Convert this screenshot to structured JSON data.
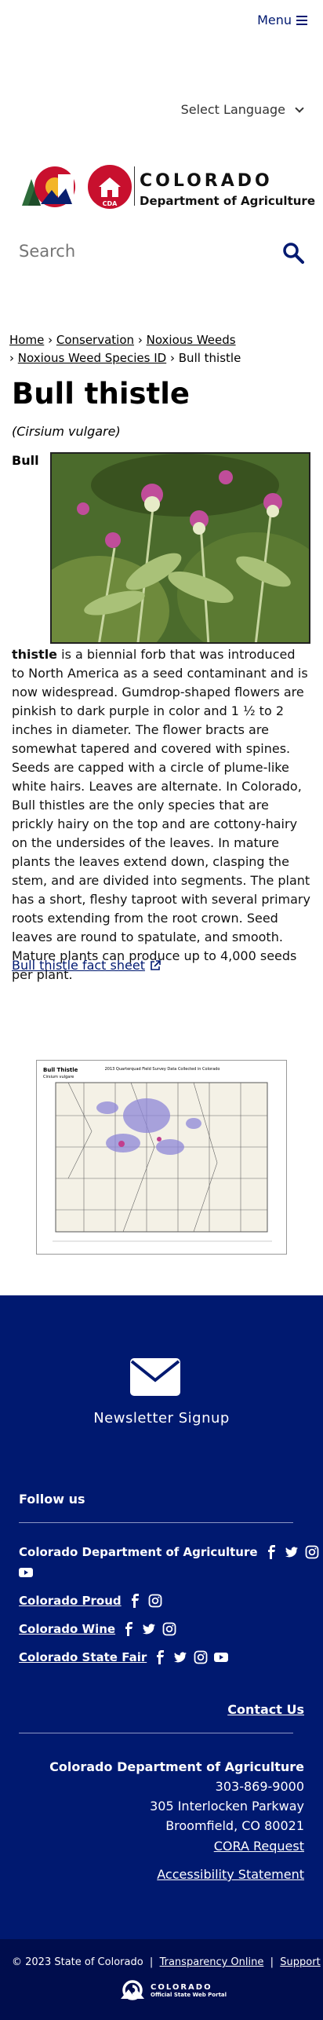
{
  "header": {
    "menu_label": "Menu",
    "language_label": "Select Language",
    "logo_title": "COLORADO",
    "logo_subtitle": "Department of Agriculture",
    "logo_badge": "CDA",
    "search_placeholder": "Search"
  },
  "breadcrumb": {
    "items": [
      "Home",
      "Conservation",
      "Noxious Weeds",
      "Noxious Weed Species ID"
    ],
    "current": "Bull thistle",
    "separator": "›"
  },
  "article": {
    "title": "Bull thistle",
    "scientific_name": "(Cirsium vulgare)",
    "lead_bold_1": "Bull",
    "lead_bold_2": "thistle",
    "body": " is a biennial forb that was introduced to North America as a seed contaminant and is now widespread. Gumdrop-shaped flowers are pinkish to dark purple in color and 1 ½ to 2 inches in diameter. The flower bracts are somewhat tapered and covered with spines. Seeds are capped with a circle of plume-like white hairs. Leaves are alternate. In Colorado, Bull thistles are the only species that are prickly hairy on the top and are cottony-hairy on the undersides of the leaves. In mature plants the leaves extend down, clasping the stem, and are divided into segments. The plant has a short, fleshy taproot with several primary roots extending from the root crown. Seed leaves are round to spatulate, and smooth. Mature plants can produce up to 4,000 seeds per plant.",
    "fact_sheet_link": "Bull thistle fact sheet",
    "map_title": "Bull Thistle",
    "map_subtitle": "Cirsium vulgare",
    "map_header": "2013 Quarterquad Field Survey Data Collected in Colorado"
  },
  "footer": {
    "newsletter": "Newsletter Signup",
    "follow_us": "Follow us",
    "social_groups": [
      {
        "name": "Colorado Department of Agriculture",
        "icons": [
          "facebook-icon",
          "twitter-icon",
          "instagram-icon",
          "youtube-icon"
        ]
      },
      {
        "name": "Colorado Proud",
        "icons": [
          "facebook-icon",
          "instagram-icon"
        ]
      },
      {
        "name": "Colorado Wine",
        "icons": [
          "facebook-icon",
          "twitter-icon",
          "instagram-icon"
        ]
      },
      {
        "name": "Colorado State Fair",
        "icons": [
          "facebook-icon",
          "twitter-icon",
          "instagram-icon",
          "youtube-icon"
        ]
      }
    ],
    "contact_us": "Contact Us",
    "org_name": "Colorado Department of Agriculture",
    "phone": "303-869-9000",
    "address_1": "305 Interlocken Parkway",
    "address_2": "Broomfield, CO 80021",
    "cora": "CORA Request",
    "accessibility": "Accessibility Statement",
    "copyright": "© 2023 State of Colorado",
    "transparency": "Transparency Online",
    "support": "Support",
    "state_logo_title": "COLORADO",
    "state_logo_subtitle": "Official State Web Portal"
  },
  "colors": {
    "brand_navy": "#001970",
    "footer_bottom": "#000d4d",
    "logo_red": "#c8102e",
    "logo_green": "#2e6b3a",
    "logo_gold": "#f3b52a"
  }
}
